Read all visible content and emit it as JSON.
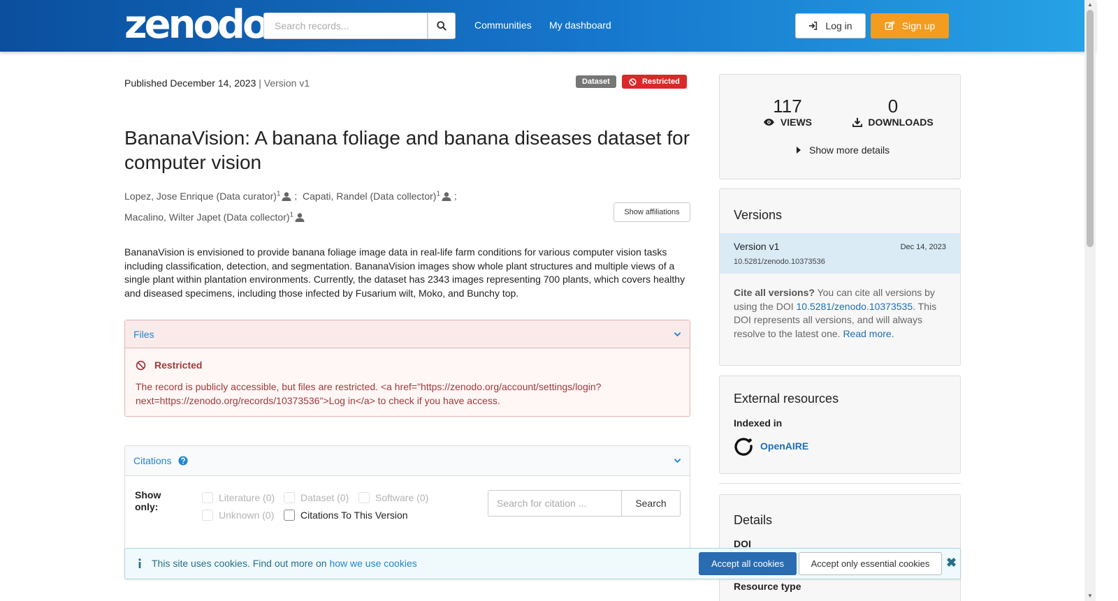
{
  "header": {
    "logo_text": "zenodo",
    "search_placeholder": "Search records...",
    "nav": [
      "Communities",
      "My dashboard"
    ],
    "login_label": "Log in",
    "signup_label": "Sign up"
  },
  "record": {
    "published_prefix": "Published",
    "published_date": "December 14, 2023",
    "version_text": "| Version v1",
    "badge_type": "Dataset",
    "badge_access": "Restricted",
    "title": "BananaVision: A banana foliage and banana diseases dataset for computer vision",
    "creators": [
      {
        "name": "Lopez, Jose Enrique (Data curator)",
        "affil": "1",
        "sep": ";"
      },
      {
        "name": "Capati, Randel (Data collector)",
        "affil": "1",
        "sep": ";"
      },
      {
        "name": "Macalino, Wilter Japet (Data collector)",
        "affil": "1",
        "sep": ""
      }
    ],
    "show_affiliations": "Show affiliations",
    "description": "BananaVision is envisioned to provide banana foliage image data in real-life farm conditions for various computer vision tasks including classification, detection, and segmentation.  BananaVision images show whole plant structures and multiple views of a single plant within plantation environments. Currently, the dataset has 2343 images representing 700 plants, which covers healthy and diseased specimens, including those infected by Fusarium wilt, Moko, and Bunchy top."
  },
  "files": {
    "header": "Files",
    "restricted_title": "Restricted",
    "restricted_msg": "The record is publicly accessible, but files are restricted. <a href=\"https://zenodo.org/account/settings/login?next=https://zenodo.org/records/10373536\">Log in</a> to check if you have access."
  },
  "citations": {
    "header": "Citations",
    "show_only": "Show only:",
    "filters": [
      "Literature (0)",
      "Dataset (0)",
      "Software (0)",
      "Unknown (0)",
      "Citations To This Version"
    ],
    "search_placeholder": "Search for citation ...",
    "search_button": "Search"
  },
  "stats": {
    "views": "117",
    "views_label": "VIEWS",
    "downloads": "0",
    "downloads_label": "DOWNLOADS",
    "more_details": "Show more details"
  },
  "versions": {
    "title": "Versions",
    "current_name": "Version v1",
    "current_date": "Dec 14, 2023",
    "current_doi": "10.5281/zenodo.10373536",
    "cite_all_bold": "Cite all versions?",
    "cite_all_text1": " You can cite all versions by using the DOI ",
    "concept_doi": "10.5281/zenodo.10373535",
    "cite_all_text2": ". This DOI represents all versions, and will always resolve to the latest one. ",
    "read_more": "Read more."
  },
  "external": {
    "title": "External resources",
    "indexed_in": "Indexed in",
    "openaire": "OpenAIRE"
  },
  "details": {
    "title": "Details",
    "doi_label": "DOI",
    "resource_type_label": "Resource type"
  },
  "cookies": {
    "text": "This site uses cookies. Find out more on ",
    "link": "how we use cookies",
    "accept_all": "Accept all cookies",
    "accept_essential": "Accept only essential cookies"
  },
  "colors": {
    "header_start": "#0b4f9e",
    "header_end": "#27a3e6",
    "signup": "#f39c1f",
    "restricted": "#db2828",
    "link": "#1f6fb5"
  }
}
